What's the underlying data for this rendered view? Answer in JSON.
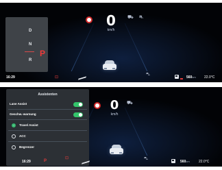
{
  "top_screen": {
    "speed": "0",
    "speed_unit": "km/h",
    "gears": {
      "d": "D",
      "n": "N",
      "r": "R",
      "active": "P"
    },
    "status": {
      "time": "16:29",
      "range_value": "560",
      "range_unit": "km",
      "temperature": "22.0°C"
    }
  },
  "bottom_screen": {
    "speed": "0",
    "speed_unit": "km/h",
    "menu": {
      "title": "Assistenten",
      "lane_assist": {
        "label": "Lane Assist",
        "enabled": true
      },
      "speed_warning": {
        "label": "Geschw.-warnung",
        "enabled": true
      },
      "options": [
        {
          "label": "Travel Assist",
          "selected": true
        },
        {
          "label": "ACC",
          "selected": false
        },
        {
          "label": "Begrenzer",
          "selected": false
        }
      ]
    },
    "status": {
      "time": "16:29",
      "gear_indicator": "P",
      "range_value": "560",
      "range_unit": "km",
      "temperature": "22.0°C"
    }
  },
  "icons": {
    "speed_limit_sign": "no-entry-sign-icon",
    "assist": "lane-assist-icon",
    "car": "car-icon",
    "fuel": "fuel-pump-icon",
    "warning": "warning-red-icon"
  },
  "colors": {
    "warning_red": "#e23b3b",
    "toggle_green": "#34c46b",
    "background": "#08101f"
  }
}
